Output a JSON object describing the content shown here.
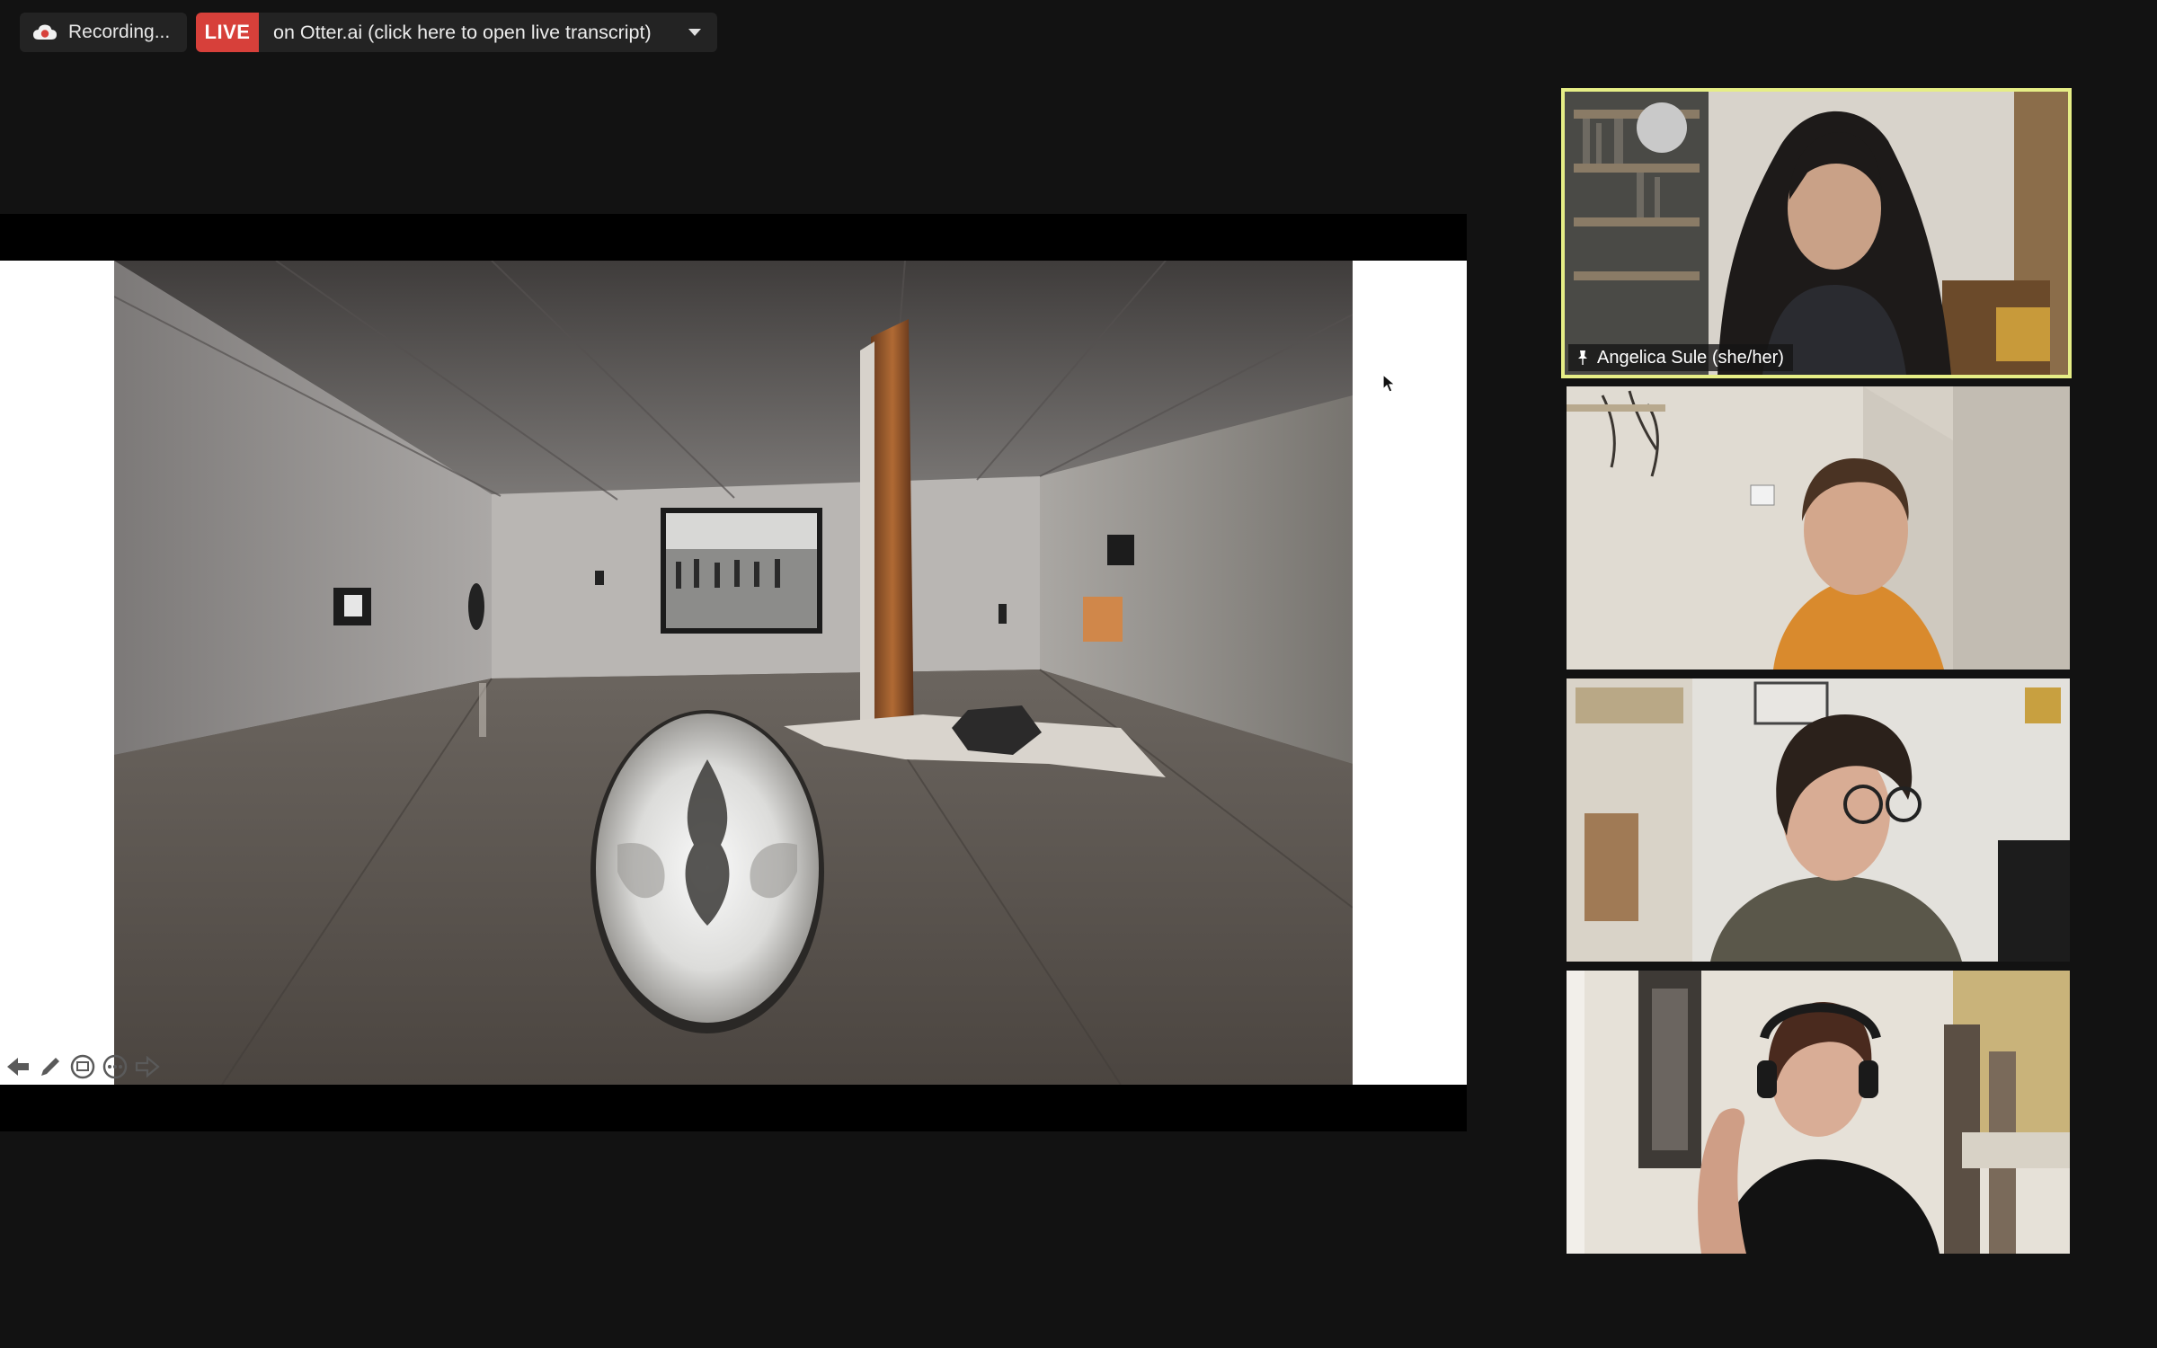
{
  "recording": {
    "label": "Recording...",
    "icon": "cloud-recording-icon"
  },
  "live_transcript": {
    "badge": "LIVE",
    "text": "on Otter.ai (click here to open live transcript)",
    "badge_color": "#d7403a",
    "caret_icon": "chevron-down-icon"
  },
  "presentation": {
    "tools": [
      "previous-slide-icon",
      "pen-icon",
      "screen-icon",
      "more-icon",
      "next-slide-icon"
    ]
  },
  "participants": [
    {
      "name": "Angelica Sule (she/her)",
      "active": true,
      "pinned": true
    },
    {
      "name": "",
      "active": false
    },
    {
      "name": "",
      "active": false
    },
    {
      "name": "",
      "active": false
    }
  ],
  "colors": {
    "background": "#121212",
    "active_speaker_border": "#e6ee86"
  }
}
